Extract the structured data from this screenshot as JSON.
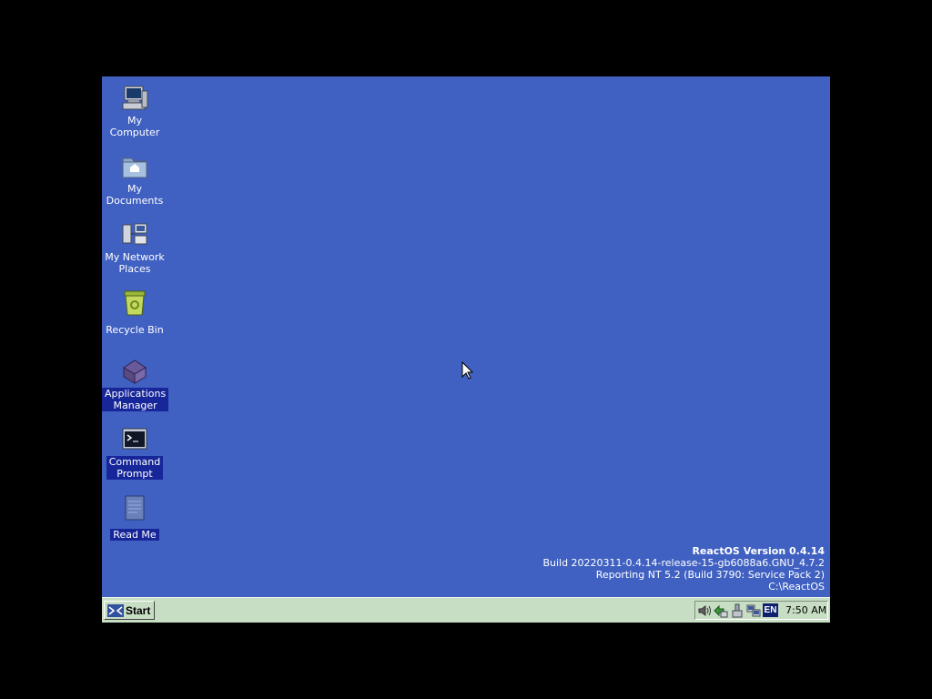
{
  "colors": {
    "desktop_background": "#4061c2",
    "taskbar_background": "#c7dec4",
    "selection_highlight": "#17279a",
    "language_badge": "#102070"
  },
  "desktop_icons": [
    {
      "label": "My\nComputer",
      "icon": "computer-icon",
      "selected": false
    },
    {
      "label": "My\nDocuments",
      "icon": "documents-folder-icon",
      "selected": false
    },
    {
      "label": "My Network\nPlaces",
      "icon": "network-places-icon",
      "selected": false
    },
    {
      "label": "Recycle Bin",
      "icon": "recycle-bin-icon",
      "selected": false
    },
    {
      "label": "Applications\nManager",
      "icon": "applications-manager-icon",
      "selected": true
    },
    {
      "label": "Command\nPrompt",
      "icon": "command-prompt-icon",
      "selected": true
    },
    {
      "label": "Read Me",
      "icon": "readme-icon",
      "selected": true
    }
  ],
  "version_info": {
    "title": "ReactOS Version 0.4.14",
    "build": "Build 20220311-0.4.14-release-15-gb6088a6.GNU_4.7.2",
    "reporting": "Reporting NT 5.2 (Build 3790: Service Pack 2)",
    "path": "C:\\ReactOS"
  },
  "taskbar": {
    "start_label": "Start",
    "tray_icons": [
      "volume-icon",
      "network-status-icon",
      "safely-remove-icon",
      "network-connection-icon"
    ],
    "language": "EN",
    "clock": "7:50 AM"
  }
}
